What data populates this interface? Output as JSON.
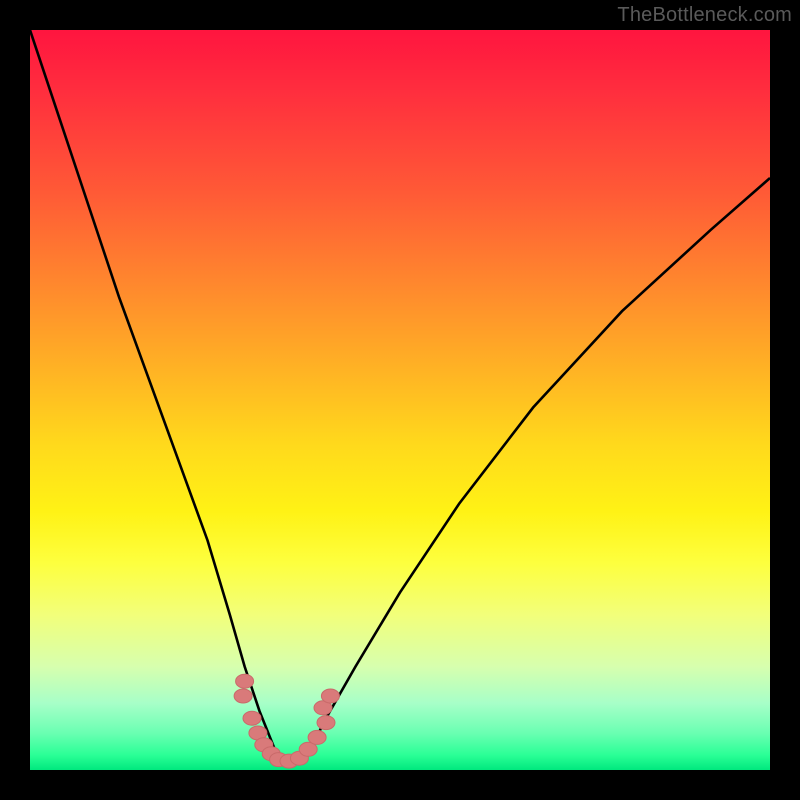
{
  "watermark": "TheBottleneck.com",
  "chart_data": {
    "type": "line",
    "title": "",
    "xlabel": "",
    "ylabel": "",
    "xlim": [
      0,
      100
    ],
    "ylim": [
      0,
      100
    ],
    "minimum_x": 34,
    "series": [
      {
        "name": "curve",
        "x": [
          0,
          4,
          8,
          12,
          16,
          20,
          24,
          27,
          29,
          31,
          33,
          34,
          36,
          38,
          40,
          44,
          50,
          58,
          68,
          80,
          92,
          100
        ],
        "y": [
          100,
          88,
          76,
          64,
          53,
          42,
          31,
          21,
          14,
          8,
          3,
          1,
          1,
          3,
          7,
          14,
          24,
          36,
          49,
          62,
          73,
          80
        ]
      }
    ],
    "markers": [
      {
        "x": 29.0,
        "y": 12.0
      },
      {
        "x": 28.8,
        "y": 10.0
      },
      {
        "x": 30.0,
        "y": 7.0
      },
      {
        "x": 30.8,
        "y": 5.0
      },
      {
        "x": 31.6,
        "y": 3.4
      },
      {
        "x": 32.6,
        "y": 2.2
      },
      {
        "x": 33.6,
        "y": 1.4
      },
      {
        "x": 35.0,
        "y": 1.2
      },
      {
        "x": 36.4,
        "y": 1.6
      },
      {
        "x": 37.6,
        "y": 2.8
      },
      {
        "x": 38.8,
        "y": 4.4
      },
      {
        "x": 40.0,
        "y": 6.4
      },
      {
        "x": 39.6,
        "y": 8.4
      },
      {
        "x": 40.6,
        "y": 10.0
      }
    ]
  },
  "colors": {
    "curve_stroke": "#000000",
    "marker_fill": "#d97a7a"
  }
}
